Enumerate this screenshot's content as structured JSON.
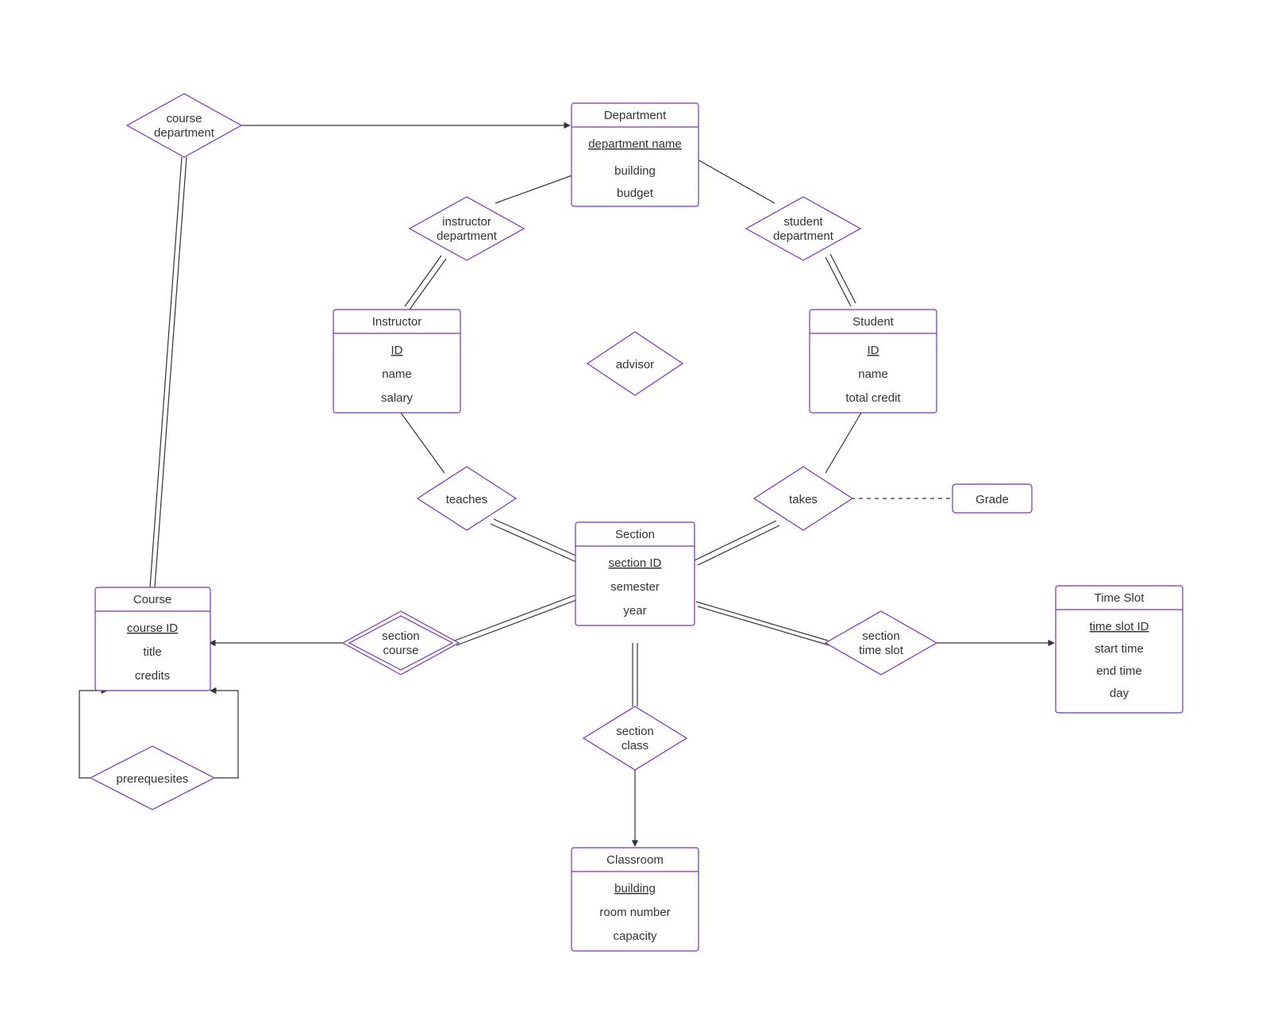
{
  "entities": {
    "department": {
      "title": "Department",
      "key": "department name",
      "a1": "building",
      "a2": "budget"
    },
    "instructor": {
      "title": "Instructor",
      "key": "ID",
      "a1": "name",
      "a2": "salary"
    },
    "student": {
      "title": "Student",
      "key": "ID",
      "a1": "name",
      "a2": "total credit"
    },
    "course": {
      "title": "Course",
      "key": "course ID",
      "a1": "title",
      "a2": "credits"
    },
    "section": {
      "title": "Section",
      "key": "section ID",
      "a1": "semester",
      "a2": "year"
    },
    "classroom": {
      "title": "Classroom",
      "key": "building",
      "a1": "room number",
      "a2": "capacity"
    },
    "timeslot": {
      "title": "Time Slot",
      "key": "time slot ID",
      "a1": "start time",
      "a2": "end time",
      "a3": "day"
    }
  },
  "relationships": {
    "course_department": {
      "l1": "course",
      "l2": "department"
    },
    "instructor_department": {
      "l1": "instructor",
      "l2": "department"
    },
    "student_department": {
      "l1": "student",
      "l2": "department"
    },
    "advisor": {
      "l1": "advisor"
    },
    "teaches": {
      "l1": "teaches"
    },
    "takes": {
      "l1": "takes"
    },
    "section_course": {
      "l1": "section",
      "l2": "course"
    },
    "section_class": {
      "l1": "section",
      "l2": "class"
    },
    "section_time_slot": {
      "l1": "section",
      "l2": "time slot"
    },
    "prerequisites": {
      "l1": "prerequesites"
    }
  },
  "attributes": {
    "grade": {
      "label": "Grade"
    }
  }
}
